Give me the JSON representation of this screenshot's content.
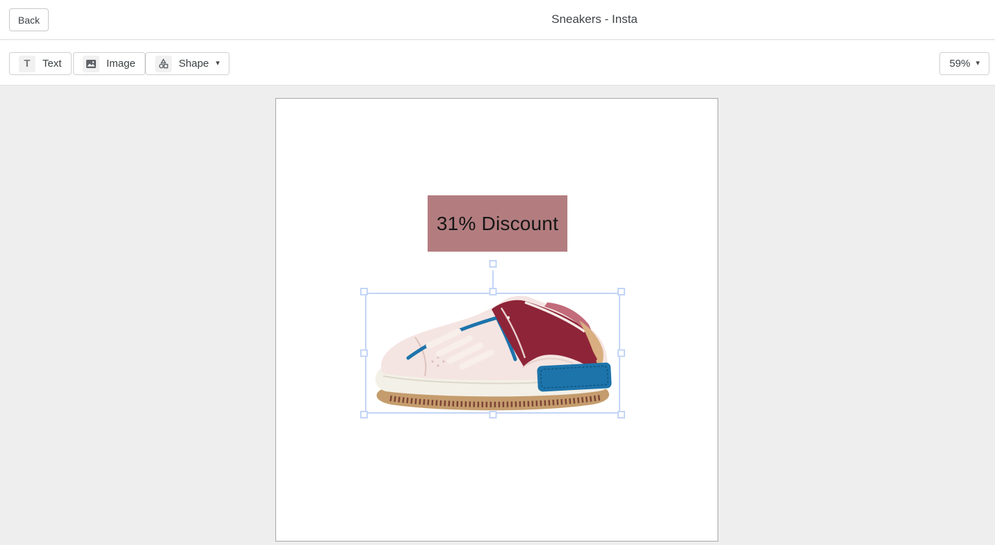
{
  "header": {
    "back_label": "Back",
    "title": "Sneakers - Insta"
  },
  "toolbar": {
    "text_button": {
      "label": "Text",
      "icon": "T-letter-icon",
      "icon_glyph": "T"
    },
    "image_button": {
      "label": "Image",
      "icon": "picture-icon"
    },
    "shape_button": {
      "label": "Shape",
      "icon": "shapes-icon",
      "caret": "▾"
    },
    "zoom_control": {
      "value": "59%",
      "caret": "▾"
    }
  },
  "canvas": {
    "discount_banner": {
      "text": "31% Discount",
      "background_color": "#b37d80",
      "text_color": "#161616"
    },
    "sneaker_image": {
      "name": "sneaker-product-photo",
      "colors": {
        "upper": "#f5e5e2",
        "heel_panel": "#8e2438",
        "blue_accent": "#1d74ab",
        "outsole": "#c59c6d",
        "midsole": "#f3f0e7",
        "heel_tab": "#d9ae80"
      }
    },
    "selection": {
      "selected_element": "sneaker-image",
      "handle_color": "#c3d4f6",
      "handles": [
        "nw",
        "n",
        "ne",
        "w",
        "e",
        "sw",
        "s",
        "se",
        "rotate"
      ]
    }
  }
}
